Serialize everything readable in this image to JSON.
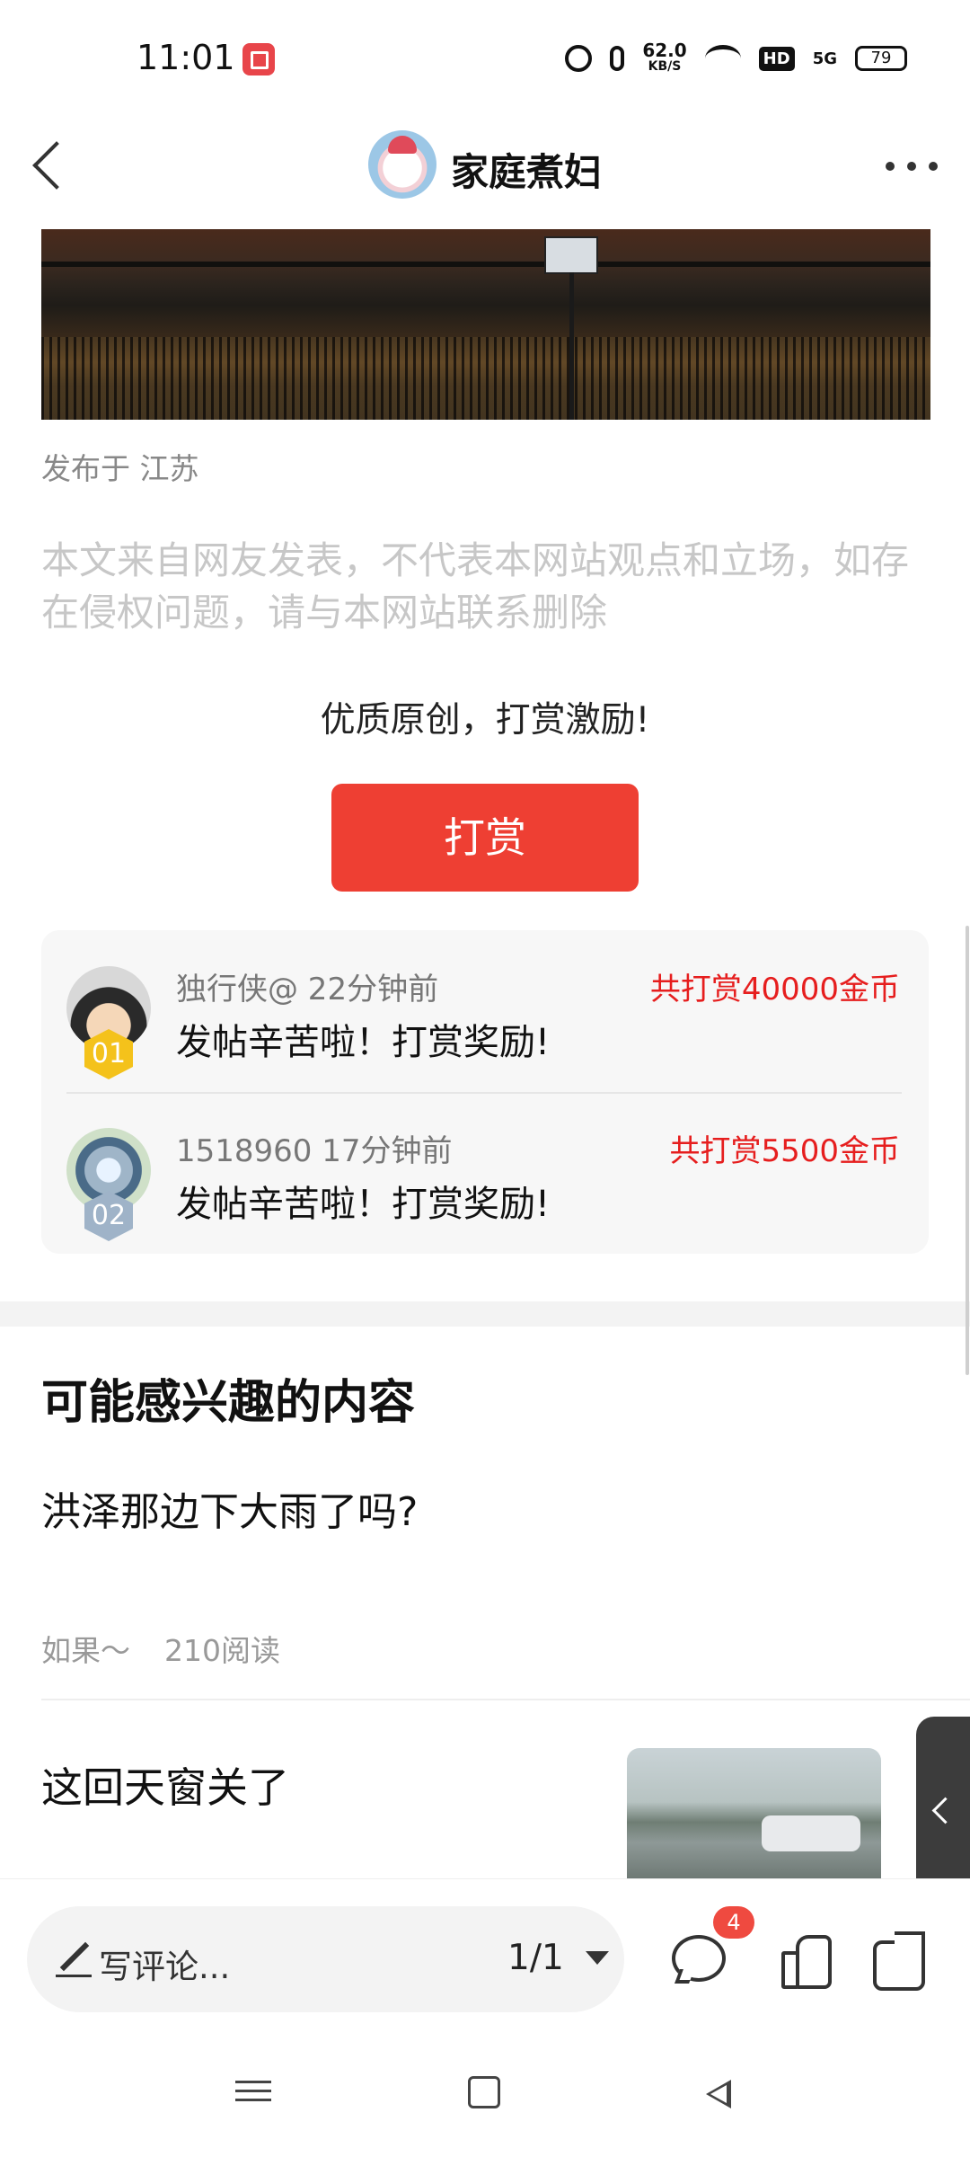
{
  "status_bar": {
    "time": "11:01",
    "speed_value": "62.0",
    "speed_unit": "KB/S",
    "hd_label": "HD",
    "network": "5G",
    "battery": "79"
  },
  "header": {
    "title": "家庭煮妇"
  },
  "post": {
    "publish_location": "发布于 江苏",
    "disclaimer": "本文来自网友发表，不代表本网站观点和立场，如存在侵权问题，请与本网站联系删除"
  },
  "reward": {
    "prompt": "优质原创，打赏激励!",
    "button_label": "打赏",
    "entries": [
      {
        "rank": "01",
        "user": "独行侠@ 22分钟前",
        "amount": "共打赏40000金币",
        "message": "发帖辛苦啦！打赏奖励!"
      },
      {
        "rank": "02",
        "user": "1518960 17分钟前",
        "amount": "共打赏5500金币",
        "message": "发帖辛苦啦！打赏奖励!"
      }
    ]
  },
  "recommend": {
    "title": "可能感兴趣的内容",
    "items": [
      {
        "title": "洪泽那边下大雨了吗?",
        "author": "如果～",
        "reads": "210阅读"
      },
      {
        "title": "这回天窗关了"
      }
    ]
  },
  "bottom_bar": {
    "comment_placeholder": "写评论...",
    "page_indicator": "1/1",
    "comment_count": "4"
  },
  "colors": {
    "accent_red": "#ee3f33",
    "reward_amount": "#e61e1e"
  },
  "icons": [
    "back-icon",
    "more-icon",
    "pen-icon",
    "dropdown-icon",
    "comment-icon",
    "like-icon",
    "share-icon",
    "chevron-left-icon",
    "menu-icon",
    "home-icon",
    "nav-back-icon"
  ]
}
